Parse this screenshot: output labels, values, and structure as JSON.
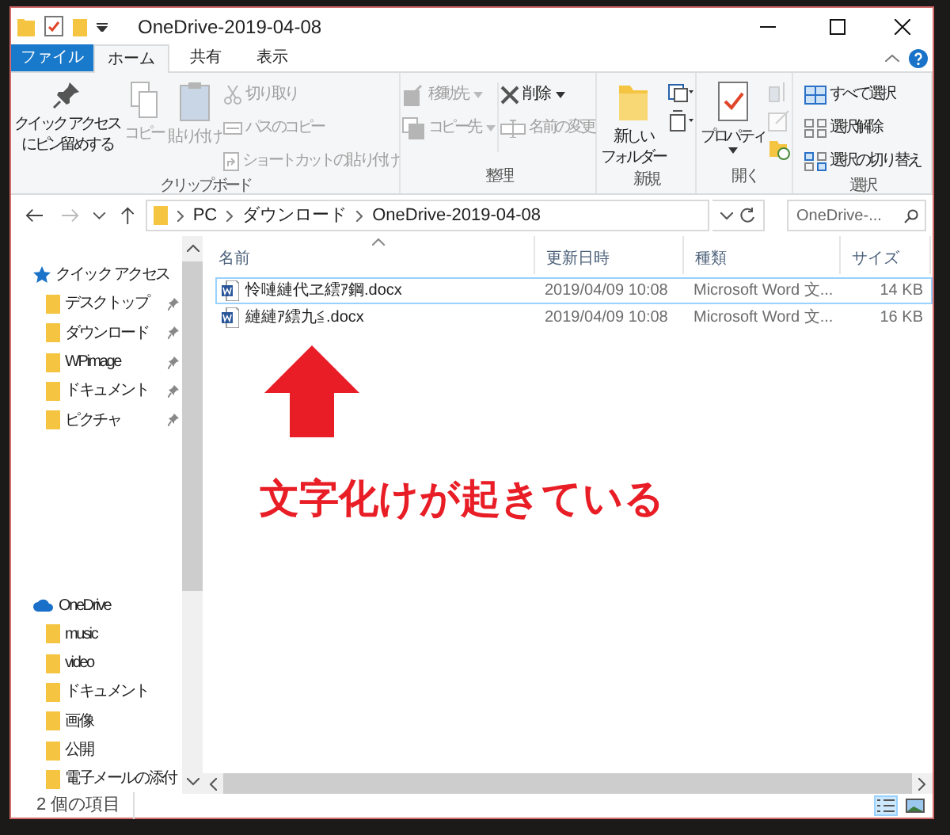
{
  "window": {
    "title": "OneDrive-2019-04-08"
  },
  "ribbon": {
    "file_tab": "ファイル",
    "tabs": [
      {
        "label": "ホーム",
        "selected": true
      },
      {
        "label": "共有",
        "selected": false
      },
      {
        "label": "表示",
        "selected": false
      }
    ],
    "groups": [
      {
        "label": "クリップボード",
        "commands": [
          {
            "kind": "large",
            "lines": [
              "クイック アクセス",
              "にピン留めする"
            ],
            "disabled": false
          },
          {
            "kind": "large",
            "label": "コピー",
            "disabled": true
          },
          {
            "kind": "large",
            "label": "貼り付け",
            "disabled": true
          },
          {
            "kind": "small",
            "label": "切り取り",
            "disabled": true
          },
          {
            "kind": "small",
            "label": "パスのコピー",
            "disabled": true
          },
          {
            "kind": "small",
            "label": "ショートカットの貼り付け",
            "disabled": true
          }
        ]
      },
      {
        "label": "整理",
        "commands": [
          {
            "kind": "small",
            "label": "移動先",
            "disabled": true
          },
          {
            "kind": "small",
            "label": "コピー先",
            "disabled": true
          },
          {
            "kind": "break"
          },
          {
            "kind": "small",
            "label": "削除",
            "disabled": false
          },
          {
            "kind": "small",
            "label": "名前の変更",
            "disabled": true
          }
        ]
      },
      {
        "label": "新規",
        "commands": [
          {
            "kind": "large",
            "lines": [
              "新しい",
              "フォルダー"
            ],
            "disabled": false
          },
          {
            "kind": "icon",
            "disabled": false
          },
          {
            "kind": "icon",
            "disabled": false
          }
        ]
      },
      {
        "label": "開く",
        "commands": [
          {
            "kind": "large",
            "label": "プロパティ",
            "disabled": false
          },
          {
            "kind": "icon",
            "disabled": true
          },
          {
            "kind": "icon",
            "disabled": true
          },
          {
            "kind": "icon",
            "disabled": false
          }
        ]
      },
      {
        "label": "選択",
        "commands": [
          {
            "kind": "small",
            "label": "すべて選択",
            "disabled": false
          },
          {
            "kind": "small",
            "label": "選択解除",
            "disabled": false
          },
          {
            "kind": "small",
            "label": "選択の切り替え",
            "disabled": false
          }
        ]
      }
    ]
  },
  "address": {
    "path": [
      "PC",
      "ダウンロード",
      "OneDrive-2019-04-08"
    ],
    "search_placeholder": "OneDrive-..."
  },
  "sidebar": [
    {
      "label": "クイック アクセス",
      "kind": "quick",
      "children": [
        {
          "label": "デスクトップ",
          "pinned": true
        },
        {
          "label": "ダウンロード",
          "pinned": true
        },
        {
          "label": "WPimage",
          "pinned": true
        },
        {
          "label": "ドキュメント",
          "pinned": true
        },
        {
          "label": "ピクチャ",
          "pinned": true
        }
      ]
    },
    {
      "label": "OneDrive",
      "kind": "cloud",
      "children": [
        {
          "label": "music",
          "pinned": false
        },
        {
          "label": "video",
          "pinned": false
        },
        {
          "label": "ドキュメント",
          "pinned": false
        },
        {
          "label": "画像",
          "pinned": false
        },
        {
          "label": "公開",
          "pinned": false
        },
        {
          "label": "電子メールの添付",
          "pinned": false
        }
      ]
    }
  ],
  "file_list": {
    "columns": [
      "名前",
      "更新日時",
      "種類",
      "サイズ"
    ],
    "rows": [
      {
        "name": "怜嗹縺代ヱ繧ｱ鋼.docx",
        "modified": "2019/04/09 10:08",
        "type": "Microsoft Word 文...",
        "size": "14 KB",
        "focused": true
      },
      {
        "name": "縺縺ｱ繧九≦.docx",
        "modified": "2019/04/09 10:08",
        "type": "Microsoft Word 文...",
        "size": "16 KB",
        "focused": false
      }
    ]
  },
  "annotation": {
    "text": "文字化けが起きている"
  },
  "status_bar": {
    "text": "2 個の項目",
    "views": [
      {
        "selected": true
      },
      {
        "selected": false
      }
    ]
  }
}
